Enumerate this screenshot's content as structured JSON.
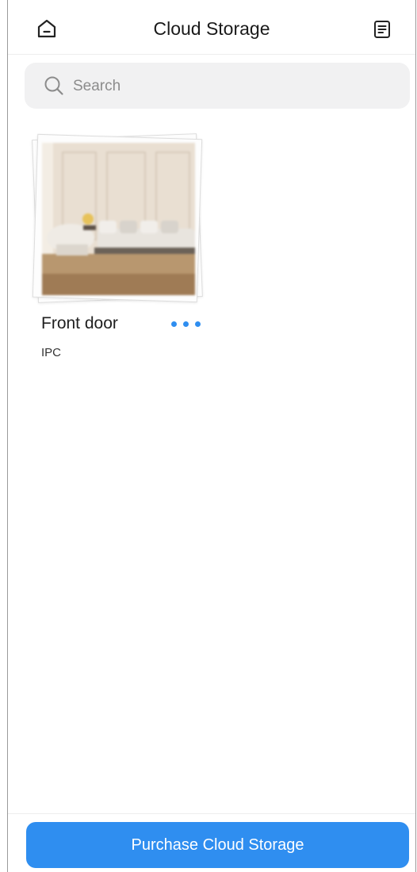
{
  "header": {
    "title": "Cloud Storage",
    "home_icon": "home-icon",
    "records_icon": "document-list-icon"
  },
  "search": {
    "placeholder": "Search",
    "icon": "search-icon"
  },
  "devices": [
    {
      "name": "Front door",
      "type": "IPC",
      "more_icon": "more-horizontal-icon",
      "accent": "#2f8ef0"
    }
  ],
  "footer": {
    "purchase_label": "Purchase Cloud Storage",
    "button_color": "#2f8ef0"
  }
}
